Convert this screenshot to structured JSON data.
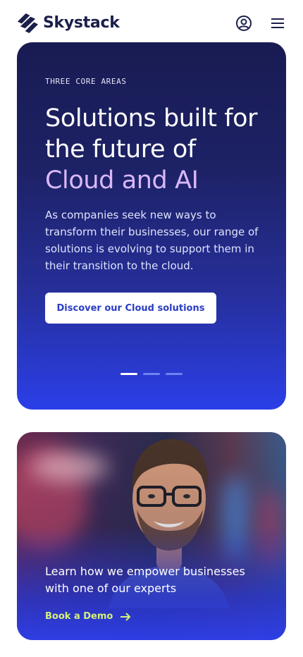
{
  "header": {
    "brand": "Skystack",
    "logo_icon": "skystack-logo-icon",
    "user_icon": "user-circle-icon",
    "menu_icon": "hamburger-menu-icon"
  },
  "hero": {
    "eyebrow": "THREE CORE AREAS",
    "headline_line1": "Solutions built for",
    "headline_line2": "the future of",
    "headline_accent": "Cloud and AI",
    "body": "As companies seek new ways to transform their businesses, our range of solutions is evolving to support them in their transition to the cloud.",
    "cta_label": "Discover our Cloud solutions",
    "carousel_total": 3,
    "carousel_active": 1
  },
  "promo": {
    "text": "Learn how we empower businesses with one of our experts",
    "link_label": "Book a Demo",
    "link_icon": "arrow-right-icon"
  },
  "colors": {
    "brand_navy": "#1b1f4b",
    "hero_gradient_top": "#191b52",
    "hero_gradient_bottom": "#2b3fe8",
    "accent_lavender": "#d9b8f8",
    "cta_text": "#2a3dc4",
    "link_lime": "#d4f07a"
  }
}
